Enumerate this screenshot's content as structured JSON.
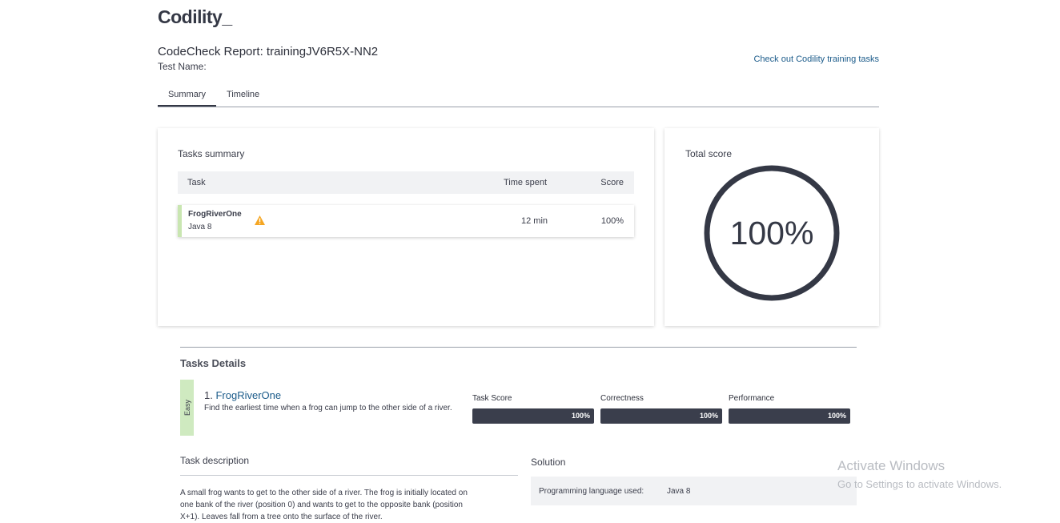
{
  "brand": {
    "logo": "Codility_"
  },
  "header": {
    "title": "CodeCheck Report: trainingJV6R5X-NN2",
    "test_name_label": "Test Name:",
    "training_link": "Check out Codility training tasks"
  },
  "tabs": [
    {
      "label": "Summary",
      "active": true
    },
    {
      "label": "Timeline",
      "active": false
    }
  ],
  "tasks_summary": {
    "title": "Tasks summary",
    "columns": [
      "Task",
      "Time spent",
      "Score"
    ],
    "rows": [
      {
        "name": "FrogRiverOne",
        "language": "Java 8",
        "warning_icon": "warning-icon",
        "time_spent": "12 min",
        "score": "100%"
      }
    ]
  },
  "total_score": {
    "title": "Total score",
    "value": "100%",
    "fraction": 1.0,
    "ring_color": "#343845"
  },
  "tasks_details": {
    "title": "Tasks Details",
    "task": {
      "difficulty": "Easy",
      "number": "1.",
      "name": "FrogRiverOne",
      "summary": "Find the earliest time when a frog can jump to the other side of a river.",
      "metrics": [
        {
          "label": "Task Score",
          "value": "100%",
          "fraction": 1.0
        },
        {
          "label": "Correctness",
          "value": "100%",
          "fraction": 1.0
        },
        {
          "label": "Performance",
          "value": "100%",
          "fraction": 1.0
        }
      ]
    },
    "description": {
      "title": "Task description",
      "text_line1": "A small frog wants to get to the other side of a river. The frog is initially located on",
      "text_line2": "one bank of the river (position 0) and wants to get to the opposite bank (position",
      "text_line3": "X+1). Leaves fall from a tree onto the surface of the river."
    },
    "solution": {
      "title": "Solution",
      "language_label": "Programming language used:",
      "language_value": "Java 8"
    }
  },
  "watermark": {
    "line1": "Activate Windows",
    "line2": "Go to Settings to activate Windows."
  },
  "colors": {
    "accent_dark": "#343845",
    "link": "#1b5b8a",
    "easy_green": "#cfeac0",
    "warning": "#f5a623"
  }
}
